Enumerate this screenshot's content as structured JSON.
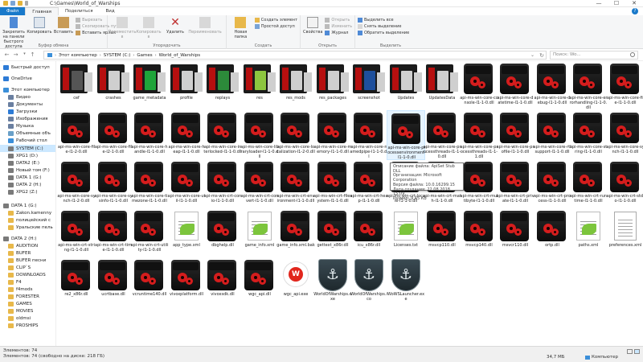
{
  "window": {
    "title": "C:\\Games\\World_of_Warships",
    "controls": [
      "—",
      "☐",
      "✕"
    ]
  },
  "ribbon_tabs": [
    {
      "label": "Файл"
    },
    {
      "label": "Главная"
    },
    {
      "label": "Поделиться"
    },
    {
      "label": "Вид"
    }
  ],
  "ribbon": {
    "clipboard": {
      "group_label": "Буфер обмена",
      "pin": "Закрепить на панели быстрого доступа",
      "copy": "Копировать",
      "paste": "Вставить",
      "cut": "Вырезать",
      "copy_path": "Скопировать путь",
      "paste_shortcut": "Вставить ярлык"
    },
    "organize": {
      "group_label": "Упорядочить",
      "move_to": "Переместить в",
      "copy_to": "Копировать в",
      "delete": "Удалить",
      "rename": "Переименовать"
    },
    "new": {
      "group_label": "Создать",
      "new_folder": "Новая папка",
      "new_item": "Создать элемент",
      "easy_access": "Простой доступ"
    },
    "open": {
      "group_label": "Открыть",
      "properties": "Свойства",
      "open": "Открыть",
      "edit": "Изменить",
      "history": "Журнал"
    },
    "select": {
      "group_label": "Выделить",
      "select_all": "Выделить все",
      "select_none": "Снять выделение",
      "invert": "Обратить выделение"
    }
  },
  "address": {
    "crumbs": [
      "Этот компьютер",
      "SYSTEM (C:)",
      "Games",
      "World_of_Warships"
    ],
    "search_placeholder": "Поиск: Wo..."
  },
  "nav": [
    {
      "label": "Быстрый доступ",
      "icon": "star-icon",
      "color": "#2d7bd6"
    },
    {
      "label": "OneDrive",
      "icon": "cloud-icon",
      "color": "#2d7bd6"
    },
    {
      "label": "Этот компьютер",
      "icon": "computer-icon",
      "color": "#3b8fd9"
    },
    {
      "label": "Видео",
      "icon": "video-folder-icon",
      "color": "#6a7fa0"
    },
    {
      "label": "Документы",
      "icon": "documents-folder-icon",
      "color": "#6a7fa0"
    },
    {
      "label": "Загрузки",
      "icon": "downloads-folder-icon",
      "color": "#2d7bd6"
    },
    {
      "label": "Изображения",
      "icon": "pictures-folder-icon",
      "color": "#6a7fa0"
    },
    {
      "label": "Музыка",
      "icon": "music-folder-icon",
      "color": "#6a7fa0"
    },
    {
      "label": "Объемные объ",
      "icon": "3d-objects-icon",
      "color": "#6aa0c8"
    },
    {
      "label": "Рабочий стол",
      "icon": "desktop-icon",
      "color": "#3b8fd9"
    },
    {
      "label": "SYSTEM (C:)",
      "icon": "drive-icon",
      "color": "#7a7a7a"
    },
    {
      "label": "XPG1 (D:)",
      "icon": "drive-icon",
      "color": "#7a7a7a"
    },
    {
      "label": "DATA2 (E:)",
      "icon": "drive-icon",
      "color": "#7a7a7a"
    },
    {
      "label": "Новый том (F:)",
      "icon": "drive-icon",
      "color": "#7a7a7a"
    },
    {
      "label": "DATA 1 (G:)",
      "icon": "drive-icon",
      "color": "#7a7a7a"
    },
    {
      "label": "DATA 2 (H:)",
      "icon": "drive-icon",
      "color": "#7a7a7a"
    },
    {
      "label": "XPG2 (Z:)",
      "icon": "drive-icon",
      "color": "#7a7a7a"
    },
    {
      "label": "DATA 1 (G:)",
      "icon": "drive-icon",
      "color": "#7a7a7a"
    },
    {
      "label": "Zakon.kamenny",
      "icon": "folder-icon",
      "color": "#e8b84a"
    },
    {
      "label": "полицейский с",
      "icon": "folder-icon",
      "color": "#e8b84a"
    },
    {
      "label": "Уральские пель",
      "icon": "folder-icon",
      "color": "#e8b84a"
    },
    {
      "label": "DATA 2 (H:)",
      "icon": "drive-icon",
      "color": "#7a7a7a"
    },
    {
      "label": "AUDITION",
      "icon": "folder-icon",
      "color": "#e8b84a"
    },
    {
      "label": "BUFER",
      "icon": "folder-icon",
      "color": "#e8b84a"
    },
    {
      "label": "BUFER песни",
      "icon": "folder-icon",
      "color": "#e8b84a"
    },
    {
      "label": "CLIP`S",
      "icon": "folder-icon",
      "color": "#e8b84a"
    },
    {
      "label": "DOWNLOADS",
      "icon": "folder-icon",
      "color": "#e8b84a"
    },
    {
      "label": "F4",
      "icon": "folder-icon",
      "color": "#e8b84a"
    },
    {
      "label": "f4mods",
      "icon": "folder-icon",
      "color": "#e8b84a"
    },
    {
      "label": "FORESTER",
      "icon": "folder-icon",
      "color": "#e8b84a"
    },
    {
      "label": "GAMES",
      "icon": "folder-icon",
      "color": "#e8b84a"
    },
    {
      "label": "MOVIES",
      "icon": "folder-icon",
      "color": "#e8b84a"
    },
    {
      "label": "oldmsi",
      "icon": "folder-icon",
      "color": "#e8b84a"
    },
    {
      "label": "PROSHIPS",
      "icon": "folder-icon",
      "color": "#e8b84a"
    }
  ],
  "files": [
    {
      "name": "cef",
      "kind": "folder",
      "accent": "#555555"
    },
    {
      "name": "crashes",
      "kind": "folder",
      "accent": "#cfcfcf"
    },
    {
      "name": "game_metadata",
      "kind": "folder",
      "accent": "#1fa43a"
    },
    {
      "name": "profile",
      "kind": "folder",
      "accent": "#cfcfcf"
    },
    {
      "name": "replays",
      "kind": "folder",
      "accent": "#2c8a3a"
    },
    {
      "name": "res",
      "kind": "folder",
      "accent": "#8dc63f"
    },
    {
      "name": "res_mods",
      "kind": "folder",
      "accent": "#cfcfcf"
    },
    {
      "name": "res_packages",
      "kind": "folder",
      "accent": "#cfcfcf"
    },
    {
      "name": "screenshot",
      "kind": "folder",
      "accent": "#1e4f9c"
    },
    {
      "name": "Updates",
      "kind": "folder",
      "accent": "#cfcfcf"
    },
    {
      "name": "UpdatesData",
      "kind": "folder",
      "accent": "#cfcfcf"
    },
    {
      "name": "api-ms-win-core-console-l1-1-0.dll",
      "kind": "dll"
    },
    {
      "name": "api-ms-win-core-datetime-l1-1-0.dll",
      "kind": "dll"
    },
    {
      "name": "api-ms-win-core-debug-l1-1-0.dll",
      "kind": "dll"
    },
    {
      "name": "api-ms-win-core-errorhandling-l1-1-0.dll",
      "kind": "dll"
    },
    {
      "name": "api-ms-win-core-file-l1-1-0.dll",
      "kind": "dll"
    },
    {
      "name": "api-ms-win-core-file-l1-2-0.dll",
      "kind": "dll"
    },
    {
      "name": "api-ms-win-core-file-l2-1-0.dll",
      "kind": "dll"
    },
    {
      "name": "api-ms-win-core-handle-l1-1-0.dll",
      "kind": "dll"
    },
    {
      "name": "api-ms-win-core-heap-l1-1-0.dll",
      "kind": "dll"
    },
    {
      "name": "api-ms-win-core-interlocked-l1-1-0.dll",
      "kind": "dll"
    },
    {
      "name": "api-ms-win-core-libraryloader-l1-1-0.dll",
      "kind": "dll"
    },
    {
      "name": "api-ms-win-core-localization-l1-2-0.dll",
      "kind": "dll"
    },
    {
      "name": "api-ms-win-core-memory-l1-1-0.dll",
      "kind": "dll"
    },
    {
      "name": "api-ms-win-core-namedpipe-l1-1-0.dll",
      "kind": "dll"
    },
    {
      "name": "api-ms-win-core-processenvironment-l1-1-0.dll",
      "kind": "dll"
    },
    {
      "name": "api-ms-win-core-processthreads-l1-1-0.dll",
      "kind": "dll"
    },
    {
      "name": "api-ms-win-core-processthreads-l1-1-1.dll",
      "kind": "dll"
    },
    {
      "name": "api-ms-win-core-profile-l1-1-0.dll",
      "kind": "dll"
    },
    {
      "name": "api-ms-win-core-rtlsupport-l1-1-0.dll",
      "kind": "dll"
    },
    {
      "name": "api-ms-win-core-string-l1-1-0.dll",
      "kind": "dll"
    },
    {
      "name": "api-ms-win-core-synch-l1-1-0.dll",
      "kind": "dll"
    },
    {
      "name": "api-ms-win-core-synch-l1-2-0.dll",
      "kind": "dll"
    },
    {
      "name": "api-ms-win-core-sysinfo-l1-1-0.dll",
      "kind": "dll"
    },
    {
      "name": "api-ms-win-core-timezone-l1-1-0.dll",
      "kind": "dll"
    },
    {
      "name": "api-ms-win-core-util-l1-1-0.dll",
      "kind": "dll"
    },
    {
      "name": "api-ms-win-crt-conio-l1-1-0.dll",
      "kind": "dll"
    },
    {
      "name": "api-ms-win-crt-convert-l1-1-0.dll",
      "kind": "dll"
    },
    {
      "name": "api-ms-win-crt-environment-l1-1-0.dll",
      "kind": "dll"
    },
    {
      "name": "api-ms-win-crt-filesystem-l1-1-0.dll",
      "kind": "dll"
    },
    {
      "name": "api-ms-win-crt-heap-l1-1-0.dll",
      "kind": "dll"
    },
    {
      "name": "api-ms-win-crt-locale-l1-1-0.dll",
      "kind": "dll"
    },
    {
      "name": "api-ms-win-crt-math-l1-1-0.dll",
      "kind": "dll"
    },
    {
      "name": "api-ms-win-crt-multibyte-l1-1-0.dll",
      "kind": "dll"
    },
    {
      "name": "api-ms-win-crt-private-l1-1-0.dll",
      "kind": "dll"
    },
    {
      "name": "api-ms-win-crt-process-l1-1-0.dll",
      "kind": "dll"
    },
    {
      "name": "api-ms-win-crt-runtime-l1-1-0.dll",
      "kind": "dll"
    },
    {
      "name": "api-ms-win-crt-stdio-l1-1-0.dll",
      "kind": "dll"
    },
    {
      "name": "api-ms-win-crt-string-l1-1-0.dll",
      "kind": "dll"
    },
    {
      "name": "api-ms-win-crt-time-l1-1-0.dll",
      "kind": "dll"
    },
    {
      "name": "api-ms-win-crt-utility-l1-1-0.dll",
      "kind": "dll"
    },
    {
      "name": "app_type.xml",
      "kind": "xml"
    },
    {
      "name": "dbghelp.dll",
      "kind": "dll"
    },
    {
      "name": "game_info.xml",
      "kind": "xml"
    },
    {
      "name": "game_info.xml.bak",
      "kind": "dll"
    },
    {
      "name": "gettext_x86r.dll",
      "kind": "dll"
    },
    {
      "name": "icu_x86r.dll",
      "kind": "dll"
    },
    {
      "name": "Licenses.txt",
      "kind": "xml"
    },
    {
      "name": "msvcp110.dll",
      "kind": "dll"
    },
    {
      "name": "msvcp140.dll",
      "kind": "dll"
    },
    {
      "name": "msvcr110.dll",
      "kind": "dll"
    },
    {
      "name": "ortp.dll",
      "kind": "dll"
    },
    {
      "name": "paths.xml",
      "kind": "xml"
    },
    {
      "name": "preferences.xml",
      "kind": "txt"
    },
    {
      "name": "re2_x86r.dll",
      "kind": "dll"
    },
    {
      "name": "ucrtbase.dll",
      "kind": "dll"
    },
    {
      "name": "vcruntime140.dll",
      "kind": "dll"
    },
    {
      "name": "vivoxplatform.dll",
      "kind": "dll"
    },
    {
      "name": "vivoxsdk.dll",
      "kind": "dll"
    },
    {
      "name": "wgc_api.dll",
      "kind": "dll"
    },
    {
      "name": "wgc_api.exe",
      "kind": "exe-red"
    },
    {
      "name": "WorldOfWarships.exe",
      "kind": "wows"
    },
    {
      "name": "WorldOfWarships.ico",
      "kind": "wows"
    },
    {
      "name": "WoWSLauncher.exe",
      "kind": "wows"
    }
  ],
  "tooltip": {
    "lines": [
      "Описание файла: ApiSet Stub DLL",
      "Организация: Microsoft Corporation",
      "Версия файла: 10.0.16299.15",
      "Дата создания: 22.08.2018 15:09",
      "Размер: 9,45 КБ"
    ]
  },
  "status": {
    "count": "Элементов: 74",
    "free": "Элементов: 74 (свободно на диске: 218 ГБ)",
    "size": "34,7 МБ",
    "computer": "Компьютер"
  }
}
